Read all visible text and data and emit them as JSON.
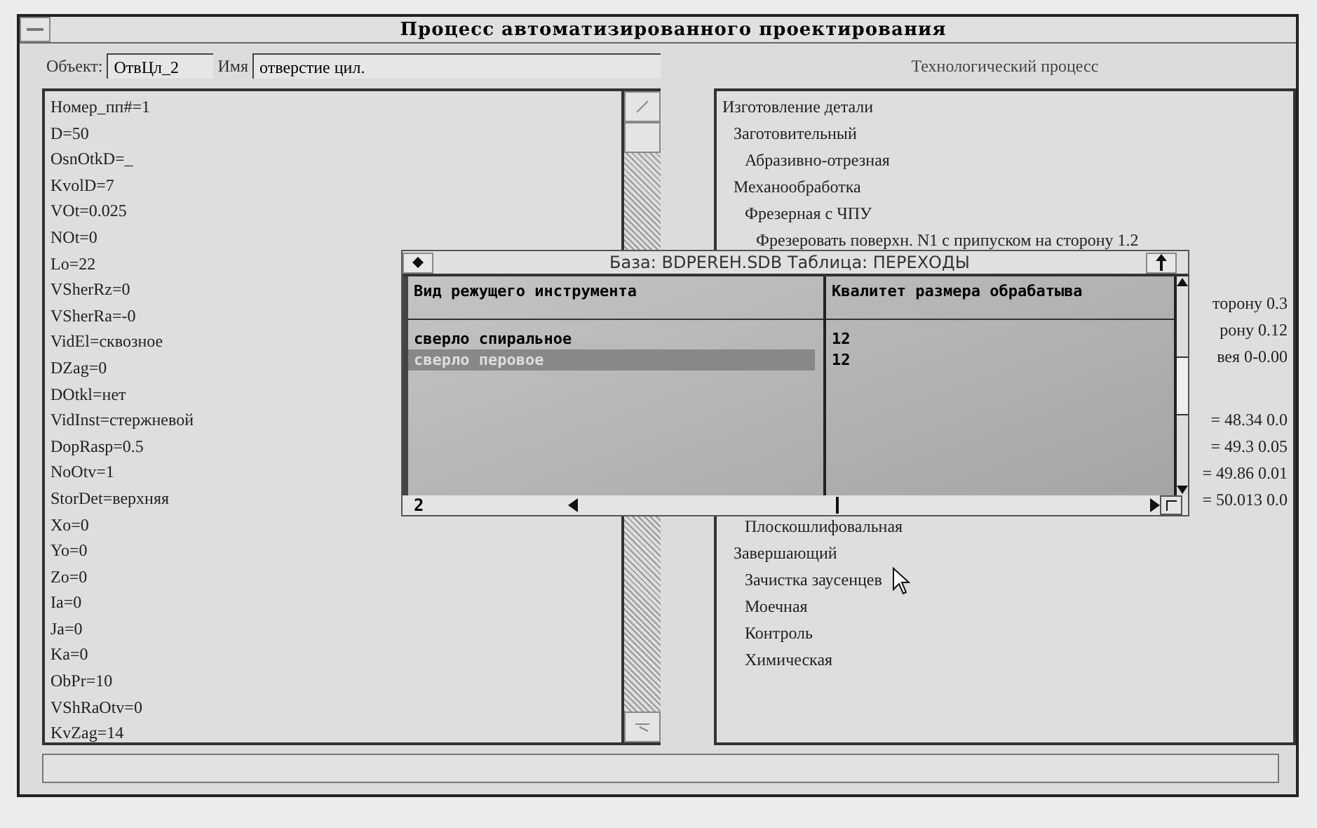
{
  "window": {
    "title": "Процесс автоматизированного проектирования"
  },
  "object": {
    "label": "Объект:",
    "value": "ОтвЦл_2"
  },
  "name": {
    "label": "Имя",
    "value": "отверстие цил."
  },
  "parameters": [
    "Номер_пп#=1",
    "D=50",
    "OsnOtkD=_",
    "KvolD=7",
    "VOt=0.025",
    "NOt=0",
    "Lo=22",
    "VSherRz=0",
    "VSherRa=-0",
    "VidEl=сквозное",
    "DZag=0",
    "DOtkl=нет",
    "VidInst=стержневой",
    "DopRasp=0.5",
    "NoOtv=1",
    "StorDet=верхняя",
    "Xo=0",
    "Yo=0",
    "Zo=0",
    "Ia=0",
    "Ja=0",
    "Ka=0",
    "ObPr=10",
    "VShRaOtv=0",
    "KvZag=14"
  ],
  "process": {
    "title": "Технологический процесс",
    "tree": [
      {
        "label": "Изготовление детали",
        "kind": "line",
        "children": [
          {
            "label": "Заготовительный",
            "kind": "line",
            "children": [
              {
                "label": "Абразивно-отрезная",
                "kind": "line"
              }
            ]
          },
          {
            "label": "Механообработка",
            "kind": "line",
            "children": [
              {
                "label": "Фрезерная с ЧПУ",
                "kind": "line",
                "children": [
                  {
                    "label": "Фрезеровать поверхн. N1 с припуском на сторону 1.2",
                    "kind": "line"
                  },
                  {
                    "kind": "covered",
                    "visible_ends": [
                      "торону 0.3",
                      "рону 0.12",
                      "вея 0-0.00"
                    ]
                  },
                  {
                    "kind": "covered",
                    "visible_ends": [
                      "= 48.34 0.0",
                      "= 49.3 0.05",
                      "= 49.86 0.01",
                      "= 50.013 0.0"
                    ]
                  }
                ]
              },
              {
                "label": "Плоскошлифовальная",
                "kind": "line"
              }
            ]
          },
          {
            "label": "Завершающий",
            "kind": "line",
            "children": [
              {
                "label": "Зачистка заусенцев",
                "kind": "line"
              },
              {
                "label": "Моечная",
                "kind": "line"
              },
              {
                "label": "Контроль",
                "kind": "line"
              },
              {
                "label": "Химическая",
                "kind": "line"
              }
            ]
          }
        ]
      }
    ]
  },
  "table_window": {
    "title": "База: BDPEREH.SDB Таблица: ПЕРЕХОДЫ",
    "columns": [
      "Вид режущего инструмента",
      "Квалитет размера обрабатыва"
    ],
    "rows": [
      {
        "cells": [
          "сверло спиральное",
          "12"
        ],
        "selected": false
      },
      {
        "cells": [
          "сверло перовое",
          "12"
        ],
        "selected": true
      }
    ],
    "record_count": "2"
  }
}
